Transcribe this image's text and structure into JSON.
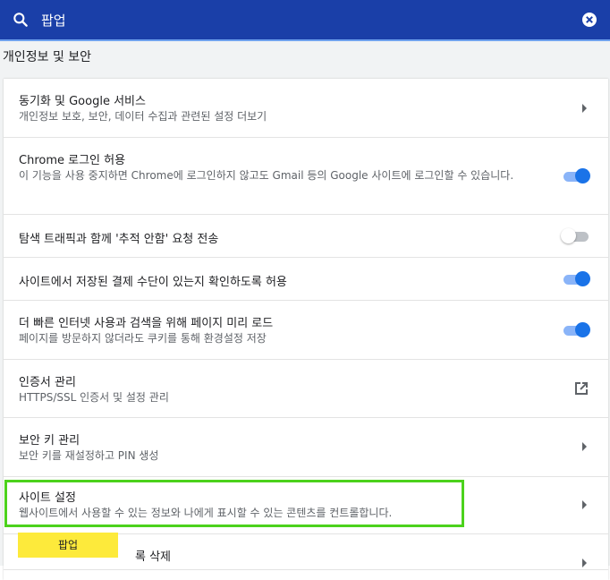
{
  "search": {
    "query": "팝업",
    "icon": "search-icon",
    "clear_icon": "clear-icon"
  },
  "section": {
    "title": "개인정보 및 보안"
  },
  "rows": [
    {
      "title": "동기화 및 Google 서비스",
      "subtitle": "개인정보 보호, 보안, 데이터 수집과 관련된 설정 더보기",
      "control": "arrow"
    },
    {
      "title": "Chrome 로그인 허용",
      "subtitle": "이 기능을 사용 중지하면 Chrome에 로그인하지 않고도 Gmail 등의 Google 사이트에 로그인할 수 있습니다.",
      "control": "toggle",
      "state": "on"
    },
    {
      "title": "탐색 트래픽과 함께 '추적 안함' 요청 전송",
      "control": "toggle",
      "state": "off"
    },
    {
      "title": "사이트에서 저장된 결제 수단이 있는지 확인하도록 허용",
      "control": "toggle",
      "state": "on"
    },
    {
      "title": "더 빠른 인터넷 사용과 검색을 위해 페이지 미리 로드",
      "subtitle": "페이지를 방문하지 않더라도 쿠키를 통해 환경설정 저장",
      "control": "toggle",
      "state": "on"
    },
    {
      "title": "인증서 관리",
      "subtitle": "HTTPS/SSL 인증서 및 설정 관리",
      "control": "external-link"
    },
    {
      "title": "보안 키 관리",
      "subtitle": "보안 키를 재설정하고 PIN 생성",
      "control": "arrow"
    },
    {
      "title": "사이트 설정",
      "subtitle": "웹사이트에서 사용할 수 있는 정보와 나에게 표시할 수 있는 콘텐츠를 컨트롤합니다.",
      "control": "arrow"
    },
    {
      "title": "록 삭제",
      "control": "arrow"
    }
  ],
  "highlight_tag": "팝업",
  "colors": {
    "topbar": "#1a3fa8",
    "toggle_on": "#1a73e8",
    "highlight": "#4cd21c",
    "tag": "#fdea3b"
  }
}
